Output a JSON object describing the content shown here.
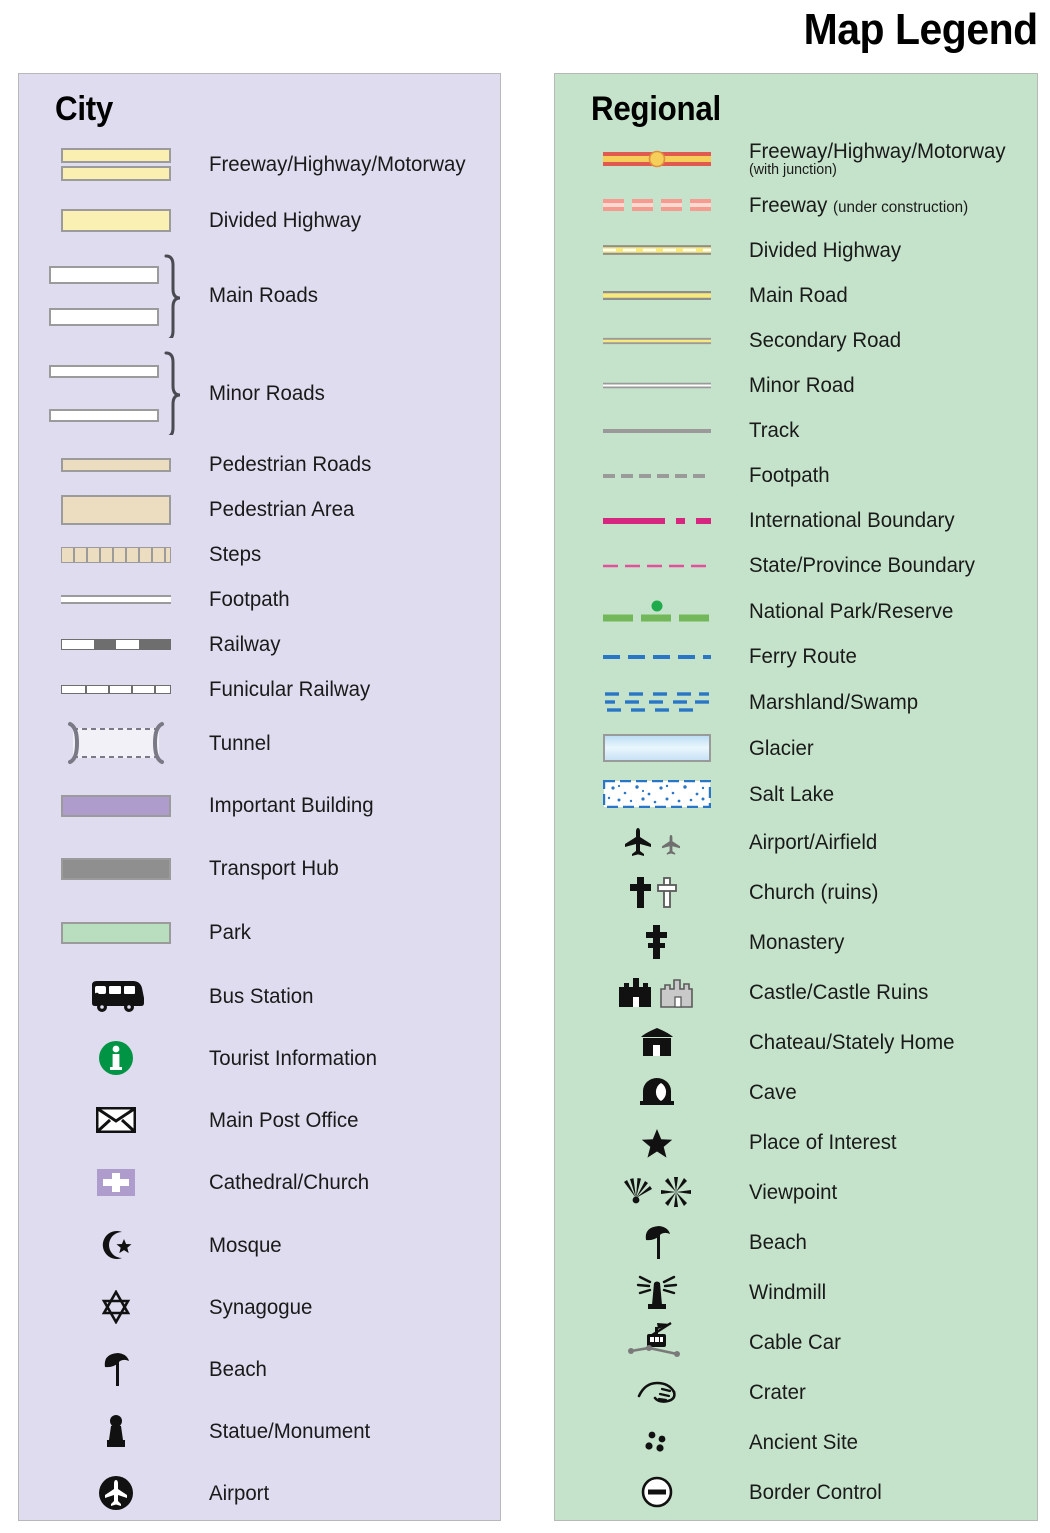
{
  "title": "Map Legend",
  "city": {
    "heading": "City",
    "items": [
      {
        "label": "Freeway/Highway/Motorway",
        "symbol": "freeway-double-yellow-bar"
      },
      {
        "label": "Divided Highway",
        "symbol": "divided-highway-yellow-bar"
      },
      {
        "label": "Main Roads",
        "symbol": "main-roads-white-bars-brace"
      },
      {
        "label": "Minor Roads",
        "symbol": "minor-roads-white-bars-brace"
      },
      {
        "label": "Pedestrian Roads",
        "symbol": "pedestrian-road-tan-bar"
      },
      {
        "label": "Pedestrian Area",
        "symbol": "pedestrian-area-tan-block"
      },
      {
        "label": "Steps",
        "symbol": "steps-hatched-bar"
      },
      {
        "label": "Footpath",
        "symbol": "footpath-thin-white-line"
      },
      {
        "label": "Railway",
        "symbol": "railway-dashed-line"
      },
      {
        "label": "Funicular Railway",
        "symbol": "funicular-ticked-line"
      },
      {
        "label": "Tunnel",
        "symbol": "tunnel-bracket-dashed"
      },
      {
        "label": "Important Building",
        "symbol": "important-building-purple-block"
      },
      {
        "label": "Transport Hub",
        "symbol": "transport-hub-gray-block"
      },
      {
        "label": "Park",
        "symbol": "park-green-block"
      },
      {
        "label": "Bus Station",
        "symbol": "bus-icon"
      },
      {
        "label": "Tourist Information",
        "symbol": "information-icon"
      },
      {
        "label": "Main Post Office",
        "symbol": "envelope-icon"
      },
      {
        "label": "Cathedral/Church",
        "symbol": "church-cross-block-icon"
      },
      {
        "label": "Mosque",
        "symbol": "crescent-star-icon"
      },
      {
        "label": "Synagogue",
        "symbol": "star-of-david-icon"
      },
      {
        "label": "Beach",
        "symbol": "parasol-icon"
      },
      {
        "label": "Statue/Monument",
        "symbol": "monument-icon"
      },
      {
        "label": "Airport",
        "symbol": "airport-circle-icon"
      }
    ]
  },
  "regional": {
    "heading": "Regional",
    "items": [
      {
        "label": "Freeway/Highway/Motorway",
        "sublabel": "(with junction)",
        "symbol": "freeway-junction-red-line"
      },
      {
        "label": "Freeway",
        "sublabel_inline": "(under construction)",
        "symbol": "freeway-under-construction-dashed"
      },
      {
        "label": "Divided Highway",
        "symbol": "divided-highway-dashed-yellow-line"
      },
      {
        "label": "Main Road",
        "symbol": "main-road-yellow-line"
      },
      {
        "label": "Secondary Road",
        "symbol": "secondary-road-thin-yellow-line"
      },
      {
        "label": "Minor Road",
        "symbol": "minor-road-white-line"
      },
      {
        "label": "Track",
        "symbol": "track-gray-line"
      },
      {
        "label": "Footpath",
        "symbol": "footpath-gray-dashed-line"
      },
      {
        "label": "International Boundary",
        "symbol": "international-boundary-magenta-dashdot"
      },
      {
        "label": "State/Province Boundary",
        "symbol": "state-boundary-pink-dashed"
      },
      {
        "label": "National Park/Reserve",
        "symbol": "national-park-green-dashed-dot"
      },
      {
        "label": "Ferry Route",
        "symbol": "ferry-route-blue-dashed"
      },
      {
        "label": "Marshland/Swamp",
        "symbol": "marshland-blue-dashes"
      },
      {
        "label": "Glacier",
        "symbol": "glacier-blue-gradient-block"
      },
      {
        "label": "Salt Lake",
        "symbol": "salt-lake-dotted-block"
      },
      {
        "label": "Airport/Airfield",
        "symbol": "plane-pair-icon"
      },
      {
        "label": "Church (ruins)",
        "symbol": "cross-pair-icon"
      },
      {
        "label": "Monastery",
        "symbol": "double-cross-icon"
      },
      {
        "label": "Castle/Castle Ruins",
        "symbol": "castle-pair-icon"
      },
      {
        "label": "Chateau/Stately Home",
        "symbol": "chateau-icon"
      },
      {
        "label": "Cave",
        "symbol": "cave-icon"
      },
      {
        "label": "Place of Interest",
        "symbol": "star-icon"
      },
      {
        "label": "Viewpoint",
        "symbol": "viewpoint-pair-icon"
      },
      {
        "label": "Beach",
        "symbol": "parasol-icon"
      },
      {
        "label": "Windmill",
        "symbol": "windmill-icon"
      },
      {
        "label": "Cable Car",
        "symbol": "cable-car-icon"
      },
      {
        "label": "Crater",
        "symbol": "crater-icon"
      },
      {
        "label": "Ancient Site",
        "symbol": "ancient-site-dots-icon"
      },
      {
        "label": "Border Control",
        "symbol": "border-control-icon"
      }
    ]
  },
  "colors": {
    "city_panel": "#dedcee",
    "regional_panel": "#c5e3ca",
    "highway_yellow": "#faeeb0",
    "freeway_red": "#e05a4f",
    "freeway_yellow": "#f5cf5a",
    "pedestrian_tan": "#ecdcc0",
    "important_building_purple": "#ae9ccd",
    "transport_hub_gray": "#8f8f8f",
    "park_green": "#b8debf",
    "boundary_magenta": "#d6267f",
    "national_park_green": "#72b75a",
    "ferry_blue": "#2a76c6",
    "information_green": "#009444"
  }
}
